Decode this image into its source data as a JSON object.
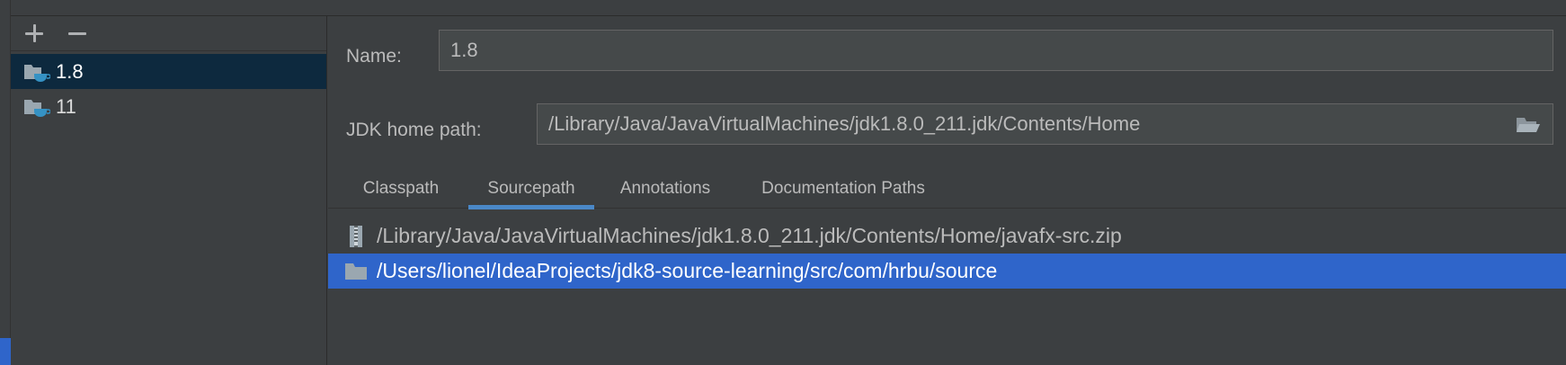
{
  "sdk_panel": {
    "add_label": "+",
    "remove_label": "−",
    "items": [
      {
        "label": "1.8",
        "icon": "jdk-folder-icon",
        "selected": true
      },
      {
        "label": "11",
        "icon": "jdk-folder-icon",
        "selected": false
      }
    ]
  },
  "detail": {
    "name_label": "Name:",
    "name_value": "1.8",
    "home_label": "JDK home path:",
    "home_value": "/Library/Java/JavaVirtualMachines/jdk1.8.0_211.jdk/Contents/Home",
    "browse_icon": "folder-open-icon"
  },
  "tabs": [
    {
      "label": "Classpath",
      "active": false
    },
    {
      "label": "Sourcepath",
      "active": true
    },
    {
      "label": "Annotations",
      "active": false
    },
    {
      "label": "Documentation Paths",
      "active": false
    }
  ],
  "paths": [
    {
      "label": "/Library/Java/JavaVirtualMachines/jdk1.8.0_211.jdk/Contents/Home/javafx-src.zip",
      "icon": "zip-archive-icon",
      "selected": false
    },
    {
      "label": "/Users/lionel/IdeaProjects/jdk8-source-learning/src/com/hrbu/source",
      "icon": "folder-icon",
      "selected": true
    }
  ],
  "colors": {
    "background": "#3c3f41",
    "selection_focused": "#2f65ca",
    "selection_unfocused": "#0d293e",
    "tab_underline": "#4a88c7",
    "jdk_cup": "#3592c4"
  }
}
